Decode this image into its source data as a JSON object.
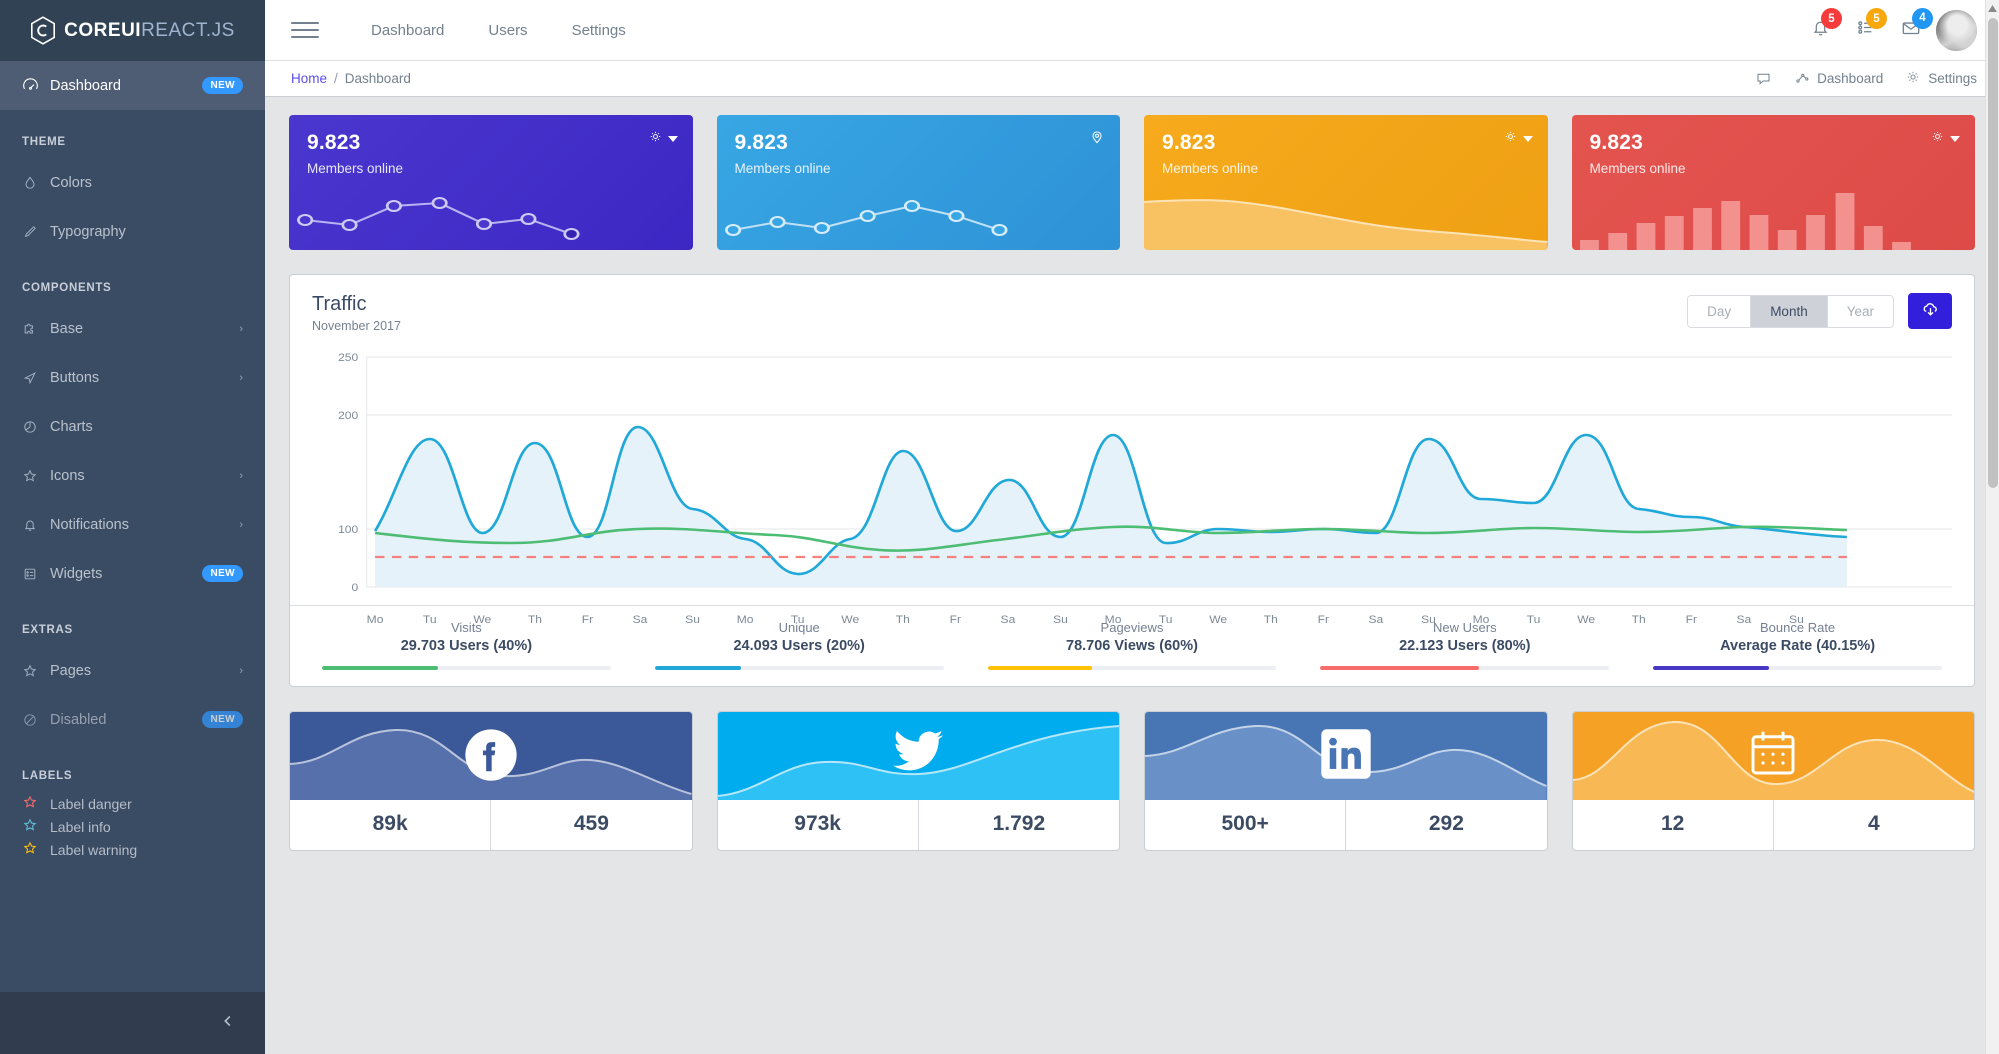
{
  "brand": {
    "name_bold": "COREUI",
    "name_light": "REACT.JS",
    "logo_icon": "coreui-hexagon-logo"
  },
  "sidebar": {
    "dashboard": {
      "label": "Dashboard",
      "badge": "NEW",
      "icon": "speedometer-icon"
    },
    "sections": [
      {
        "title": "THEME",
        "items": [
          {
            "label": "Colors",
            "icon": "drop-icon",
            "chevron": false,
            "badge": ""
          },
          {
            "label": "Typography",
            "icon": "pencil-icon",
            "chevron": false,
            "badge": ""
          }
        ]
      },
      {
        "title": "COMPONENTS",
        "items": [
          {
            "label": "Base",
            "icon": "puzzle-icon",
            "chevron": true,
            "badge": ""
          },
          {
            "label": "Buttons",
            "icon": "cursor-icon",
            "chevron": true,
            "badge": ""
          },
          {
            "label": "Charts",
            "icon": "pie-chart-icon",
            "chevron": false,
            "badge": ""
          },
          {
            "label": "Icons",
            "icon": "star-icon",
            "chevron": true,
            "badge": ""
          },
          {
            "label": "Notifications",
            "icon": "bell-icon",
            "chevron": true,
            "badge": ""
          },
          {
            "label": "Widgets",
            "icon": "calculator-icon",
            "chevron": false,
            "badge": "NEW"
          }
        ]
      },
      {
        "title": "EXTRAS",
        "items": [
          {
            "label": "Pages",
            "icon": "star-icon",
            "chevron": true,
            "badge": ""
          },
          {
            "label": "Disabled",
            "icon": "ban-icon",
            "chevron": false,
            "badge": "NEW"
          }
        ]
      }
    ],
    "labels_title": "LABELS",
    "labels": [
      {
        "label": "Label danger",
        "icon": "star-icon",
        "color": "#f86c6b"
      },
      {
        "label": "Label info",
        "icon": "star-icon",
        "color": "#63c2de"
      },
      {
        "label": "Label warning",
        "icon": "star-icon",
        "color": "#ffc107"
      }
    ],
    "minimizer_icon": "chevron-left-icon"
  },
  "header": {
    "toggler_icon": "hamburger-icon",
    "nav": [
      {
        "label": "Dashboard"
      },
      {
        "label": "Users"
      },
      {
        "label": "Settings"
      }
    ],
    "icons": [
      {
        "name": "bell-icon",
        "count": "5",
        "variant": "danger"
      },
      {
        "name": "task-list-icon",
        "count": "5",
        "variant": "warning"
      },
      {
        "name": "envelope-icon",
        "count": "4",
        "variant": "info"
      }
    ],
    "avatar_alt": "user-avatar"
  },
  "breadcrumb": {
    "home": "Home",
    "separator": "/",
    "current": "Dashboard",
    "actions": [
      {
        "label": "",
        "icon": "comment-bubble-icon"
      },
      {
        "label": "Dashboard",
        "icon": "graph-icon"
      },
      {
        "label": "Settings",
        "icon": "gear-icon"
      }
    ]
  },
  "stat_cards": [
    {
      "value": "9.823",
      "label": "Members online",
      "icon": "gear-icon",
      "caret": true,
      "color": "#4638c2",
      "color2": "#3a2fb8",
      "viz": "line-dots"
    },
    {
      "value": "9.823",
      "label": "Members online",
      "icon": "location-pin-icon",
      "caret": false,
      "color": "#2f9fe0",
      "color2": "#2a8ed0",
      "viz": "line-dots"
    },
    {
      "value": "9.823",
      "label": "Members online",
      "icon": "gear-icon",
      "caret": true,
      "color": "#f4a214",
      "color2": "#f0a01a",
      "viz": "area"
    },
    {
      "value": "9.823",
      "label": "Members online",
      "icon": "gear-icon",
      "caret": true,
      "color": "#e2504c",
      "color2": "#dd4b48",
      "viz": "bars"
    }
  ],
  "traffic": {
    "title": "Traffic",
    "subtitle": "November 2017",
    "range_buttons": [
      {
        "label": "Day",
        "active": false
      },
      {
        "label": "Month",
        "active": true
      },
      {
        "label": "Year",
        "active": false
      }
    ],
    "download_icon": "cloud-download-icon",
    "footer_stats": [
      {
        "title": "Visits",
        "value": "29.703 Users (40%)",
        "percent": 40,
        "color": "#4dbd74"
      },
      {
        "title": "Unique",
        "value": "24.093 Users (20%)",
        "percent": 20,
        "color": "#20a8d8"
      },
      {
        "title": "Pageviews",
        "value": "78.706 Views (60%)",
        "percent": 60,
        "color": "#ffc107"
      },
      {
        "title": "New Users",
        "value": "22.123 Users (80%)",
        "percent": 80,
        "color": "#f86c6b"
      },
      {
        "title": "Bounce Rate",
        "value": "Average Rate (40.15%)",
        "percent": 40,
        "color": "#4638c2"
      }
    ]
  },
  "chart_data": {
    "type": "line",
    "title": "Traffic",
    "subtitle": "November 2017",
    "xlabel": "",
    "ylabel": "",
    "ylim": [
      0,
      250
    ],
    "yticks": [
      0,
      100,
      200,
      250
    ],
    "grid": true,
    "legend": false,
    "categories": [
      "Mo",
      "Tu",
      "We",
      "Th",
      "Fr",
      "Sa",
      "Su",
      "Mo",
      "Tu",
      "We",
      "Th",
      "Fr",
      "Sa",
      "Su",
      "Mo",
      "Tu",
      "We",
      "Th",
      "Fr",
      "Sa",
      "Su",
      "Mo",
      "Tu",
      "We",
      "Th",
      "Fr",
      "Sa",
      "Su"
    ],
    "series": [
      {
        "name": "Traffic (filled)",
        "color": "#20a8d8",
        "fill": "#e7f4fb",
        "values": [
          93,
          175,
          95,
          165,
          80,
          192,
          120,
          90,
          55,
          85,
          160,
          98,
          140,
          95,
          180,
          75,
          105,
          98,
          100,
          95,
          105,
          90,
          175,
          135,
          130,
          185,
          120,
          84
        ]
      },
      {
        "name": "Average",
        "color": "#4dbd74",
        "fill": "none",
        "values": [
          90,
          84,
          82,
          85,
          90,
          92,
          88,
          78,
          70,
          75,
          85,
          92,
          88,
          86,
          90,
          86,
          92,
          88,
          90,
          92,
          86,
          90,
          92,
          88,
          92,
          90,
          94,
          90
        ]
      },
      {
        "name": "Threshold",
        "color": "#f86c6b",
        "dashed": true,
        "values": [
          65,
          65,
          65,
          65,
          65,
          65,
          65,
          65,
          65,
          65,
          65,
          65,
          65,
          65,
          65,
          65,
          65,
          65,
          65,
          65,
          65,
          65,
          65,
          65,
          65,
          65,
          65,
          65
        ]
      }
    ]
  },
  "social_cards": [
    {
      "network": "facebook",
      "icon": "facebook-icon",
      "color": "#3b5998",
      "metric1": "89k",
      "metric2": "459"
    },
    {
      "network": "twitter",
      "icon": "twitter-icon",
      "color": "#00aced",
      "metric1": "973k",
      "metric2": "1.792"
    },
    {
      "network": "linkedin",
      "icon": "linkedin-icon",
      "color": "#4875b4",
      "metric1": "500+",
      "metric2": "292"
    },
    {
      "network": "calendar",
      "icon": "calendar-icon",
      "color": "#f5a125",
      "metric1": "12",
      "metric2": "4"
    }
  ]
}
